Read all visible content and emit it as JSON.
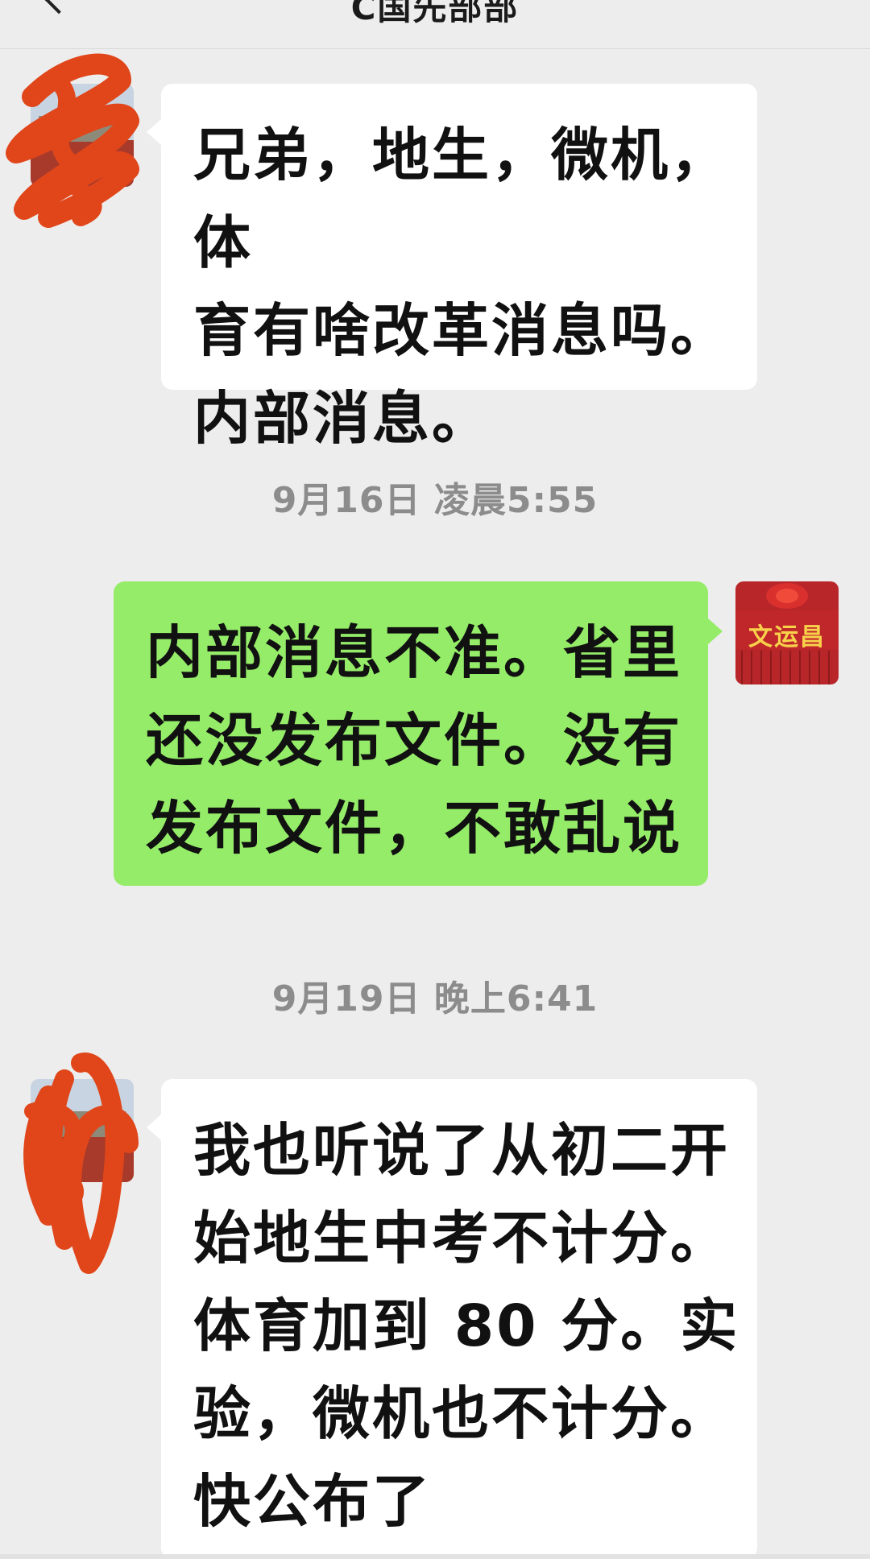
{
  "header": {
    "title": "C国先部部",
    "back_icon": "chevron-left-icon"
  },
  "colors": {
    "background": "#ededed",
    "incoming_bubble": "#ffffff",
    "outgoing_bubble": "#95ec69",
    "timestamp_text": "#8c8c8c",
    "scribble": "#e0461a"
  },
  "messages": [
    {
      "direction": "incoming",
      "text": "兄弟，地生，微机，体\n育有啥改革消息吗。\n内部消息。"
    },
    {
      "direction": "outgoing",
      "text": "内部消息不准。省里\n还没发布文件。没有\n发布文件，不敢乱说"
    },
    {
      "direction": "incoming",
      "text": "我也听说了从初二开\n始地生中考不计分。\n体育加到 80 分。实\n验，微机也不计分。\n快公布了"
    }
  ],
  "timestamps": [
    "9月16日 凌晨5:55",
    "9月19日 晚上6:41"
  ],
  "self_avatar": {
    "text": "文运昌"
  }
}
